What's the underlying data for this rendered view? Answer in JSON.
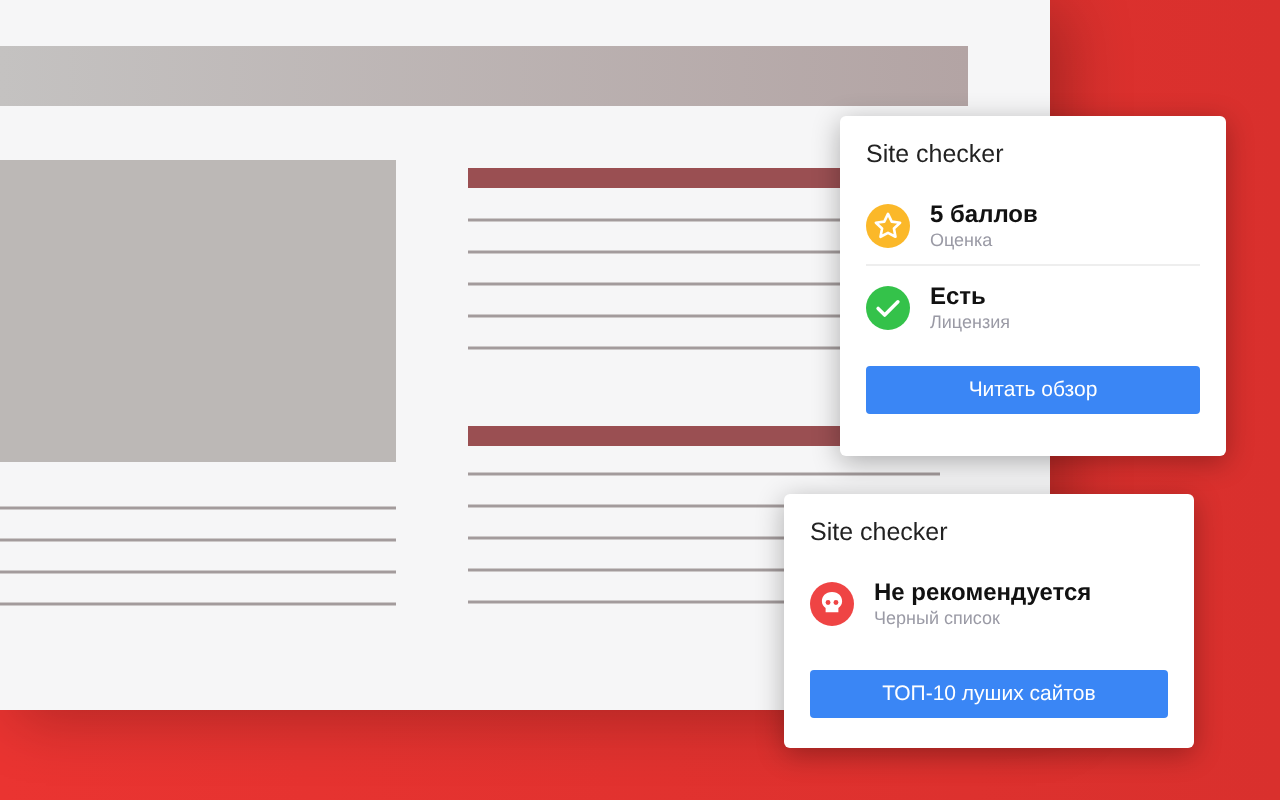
{
  "cards": [
    {
      "title": "Site checker",
      "items": [
        {
          "kind": "star",
          "color": "#fbb829",
          "label": "5 баллов",
          "caption": "Оценка"
        },
        {
          "kind": "check",
          "color": "#34c24a",
          "label": "Есть",
          "caption": "Лицензия"
        }
      ],
      "button": "Читать обзор"
    },
    {
      "title": "Site checker",
      "items": [
        {
          "kind": "skull",
          "color": "#ef4444",
          "label": "Не рекомендуется",
          "caption": "Черный список"
        }
      ],
      "button": "ТОП-10 луших сайтов"
    }
  ]
}
